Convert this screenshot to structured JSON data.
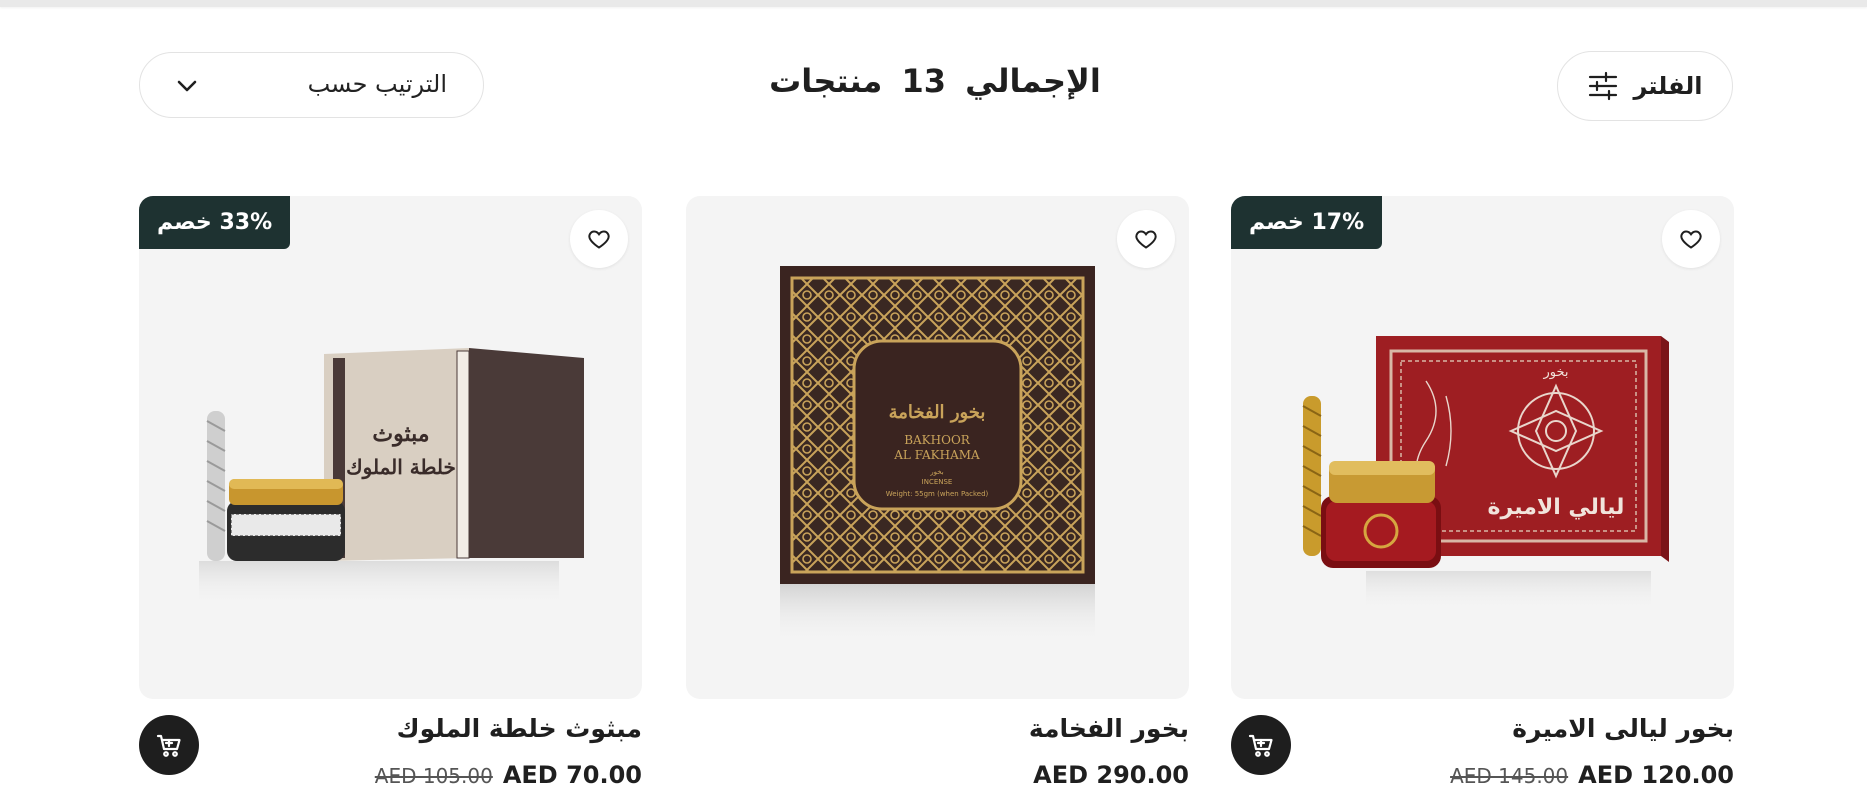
{
  "toolbar": {
    "filter_label": "الفلتر",
    "total_prefix": "الإجمالي",
    "total_count": "13",
    "total_suffix": "منتجات",
    "sort_label": "الترتيب حسب"
  },
  "products": [
    {
      "title": "بخور ليالى الاميرة",
      "price": "AED 120.00",
      "old_price": "AED 145.00",
      "badge": "17% خصم",
      "box_text": "ليالي الاميرة",
      "box_top_text": "بخور"
    },
    {
      "title": "بخور الفخامة",
      "price": "AED 290.00",
      "box_arabic": "بخور الفخامة",
      "box_latin_1": "BAKHOOR",
      "box_latin_2": "AL FAKHAMA",
      "box_small_1": "بخور",
      "box_small_2": "INCENSE",
      "box_small_3": "Weight: 55gm (when Packed)"
    },
    {
      "title": "مبثوث خلطة الملوك",
      "price": "AED 70.00",
      "old_price": "AED 105.00",
      "badge": "33% خصم",
      "box_text_1": "مبثوث",
      "box_text_2": "خلطة الملوك"
    }
  ],
  "colors": {
    "badge_bg": "#1e3231",
    "cart_bg": "#1e1e1e",
    "card_bg": "#f4f4f4"
  },
  "icons": {
    "filter": "sliders-icon",
    "sort": "chevron-down-icon",
    "favorite": "heart-icon",
    "cart": "cart-icon"
  }
}
